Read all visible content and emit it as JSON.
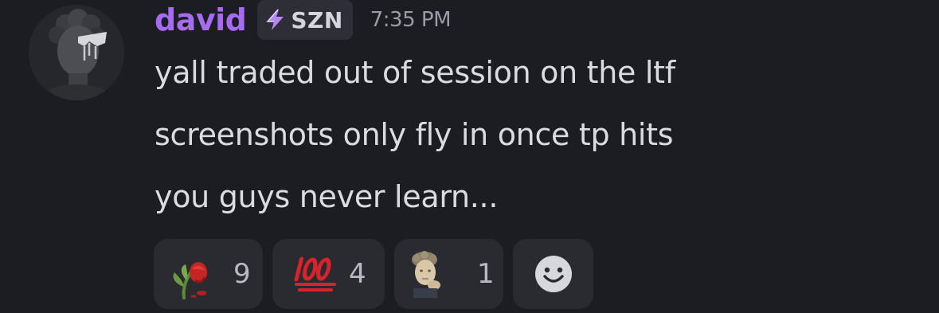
{
  "message": {
    "author": "david",
    "role_tag": "SZN",
    "timestamp": "7:35 PM",
    "lines": [
      "yall traded out of session on the ltf",
      "screenshots only fly in once tp hits",
      "you guys never learn..."
    ],
    "avatar_icon": "statue-bust-avatar"
  },
  "reactions": [
    {
      "emoji": "wilted-rose-icon",
      "count": "9"
    },
    {
      "emoji": "hundred-points-icon",
      "count": "4"
    },
    {
      "emoji": "statue-thinking-icon",
      "count": "1"
    }
  ],
  "add_reaction_icon": "smiley-add-reaction-icon",
  "colors": {
    "background": "#1c1d22",
    "username": "#a66bf0",
    "tag_bolt": "#b487f5",
    "text": "#dadce2",
    "timestamp": "#9a9ca6",
    "reaction_bg": "#2a2b31",
    "hundred_red": "#d8232a"
  }
}
